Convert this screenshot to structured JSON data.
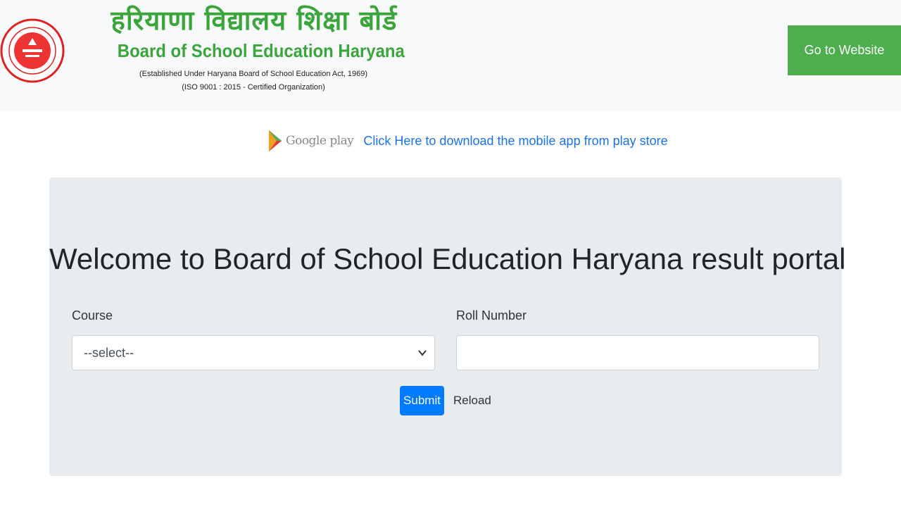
{
  "header": {
    "hindi_title": "हरियाणा विद्यालय शिक्षा बोर्ड",
    "english_title": "Board of School Education Haryana",
    "established": "(Established Under Haryana Board of School Education Act, 1969)",
    "iso": "(ISO 9001 : 2015 - Certified Organization)",
    "go_to_website_label": "Go to Website",
    "logo_icon": "board-seal-logo",
    "accent_color": "#3aa53a"
  },
  "playstore": {
    "badge_text": "Google play",
    "link_text": "Click Here to download the mobile app from play store",
    "link_color": "#1a73e8"
  },
  "portal": {
    "welcome": "Welcome to Board of School Education Haryana result portal",
    "course_label": "Course",
    "course_selected": "--select--",
    "roll_label": "Roll Number",
    "roll_value": "",
    "submit_label": "Submit",
    "reload_label": "Reload",
    "submit_color": "#007bff"
  }
}
